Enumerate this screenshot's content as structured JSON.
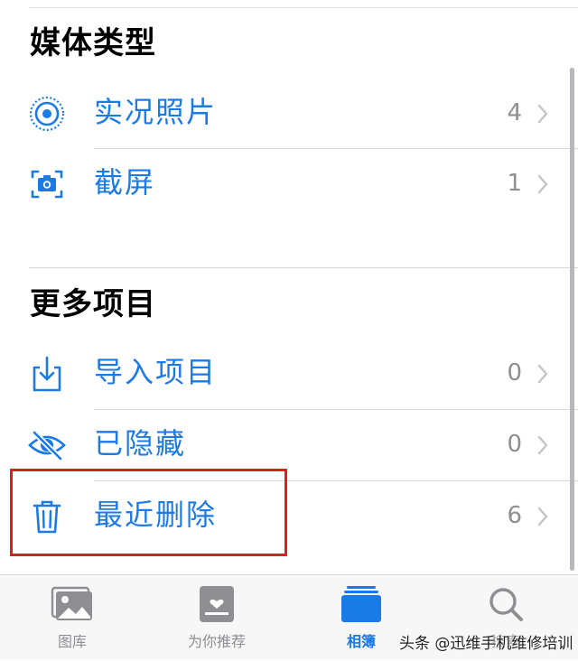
{
  "sections": [
    {
      "title": "媒体类型",
      "items": [
        {
          "label": "实况照片",
          "count": "4",
          "icon": "live-photo-icon"
        },
        {
          "label": "截屏",
          "count": "1",
          "icon": "screenshot-icon"
        }
      ]
    },
    {
      "title": "更多项目",
      "items": [
        {
          "label": "导入项目",
          "count": "0",
          "icon": "import-icon"
        },
        {
          "label": "已隐藏",
          "count": "0",
          "icon": "eye-slash-icon"
        },
        {
          "label": "最近删除",
          "count": "6",
          "icon": "trash-icon"
        }
      ]
    }
  ],
  "tabbar": {
    "tabs": [
      {
        "label": "图库",
        "icon": "photo-library-icon",
        "active": false
      },
      {
        "label": "为你推荐",
        "icon": "for-you-icon",
        "active": false
      },
      {
        "label": "相簿",
        "icon": "albums-icon",
        "active": true
      },
      {
        "label": "搜索",
        "icon": "search-icon",
        "active": false
      }
    ]
  },
  "watermark": "头条 @迅维手机维修培训",
  "colors": {
    "accent": "#1a7ae6",
    "highlight": "#d7231b",
    "secondary_text": "#8e8e93"
  }
}
